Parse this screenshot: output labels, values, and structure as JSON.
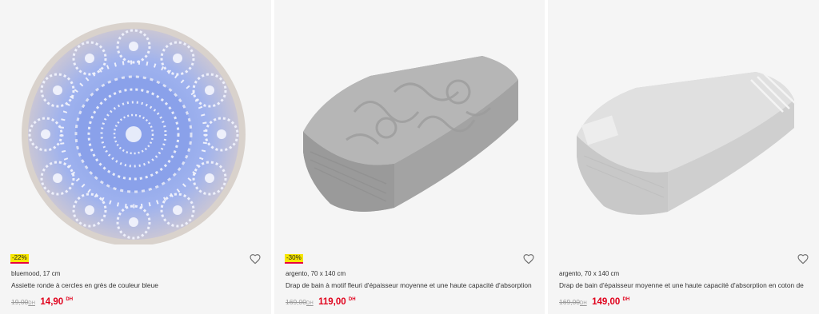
{
  "products": [
    {
      "discount": "-22%",
      "brand": "bluemood, 17 cm",
      "title": "Assiette ronde à cercles en grès de couleur bleue",
      "old_price": "19,00",
      "new_price": "14,90",
      "currency": "DH"
    },
    {
      "discount": "-30%",
      "brand": "argento, 70 x 140 cm",
      "title": "Drap de bain à motif fleuri d'épaisseur moyenne et une haute capacité d'absorption",
      "old_price": "169,00",
      "new_price": "119,00",
      "currency": "DH"
    },
    {
      "brand": "argento, 70 x 140 cm",
      "title": "Drap de bain d'épaisseur moyenne et une haute capacité d'absorption en coton de",
      "old_price": "169,00",
      "new_price": "149,00",
      "currency": "DH"
    }
  ],
  "colors": {
    "sale_red": "#e0001b",
    "badge_yellow": "#f6e600",
    "card_bg": "#f5f5f5"
  },
  "icons": {
    "wishlist": "heart-outline-icon"
  }
}
